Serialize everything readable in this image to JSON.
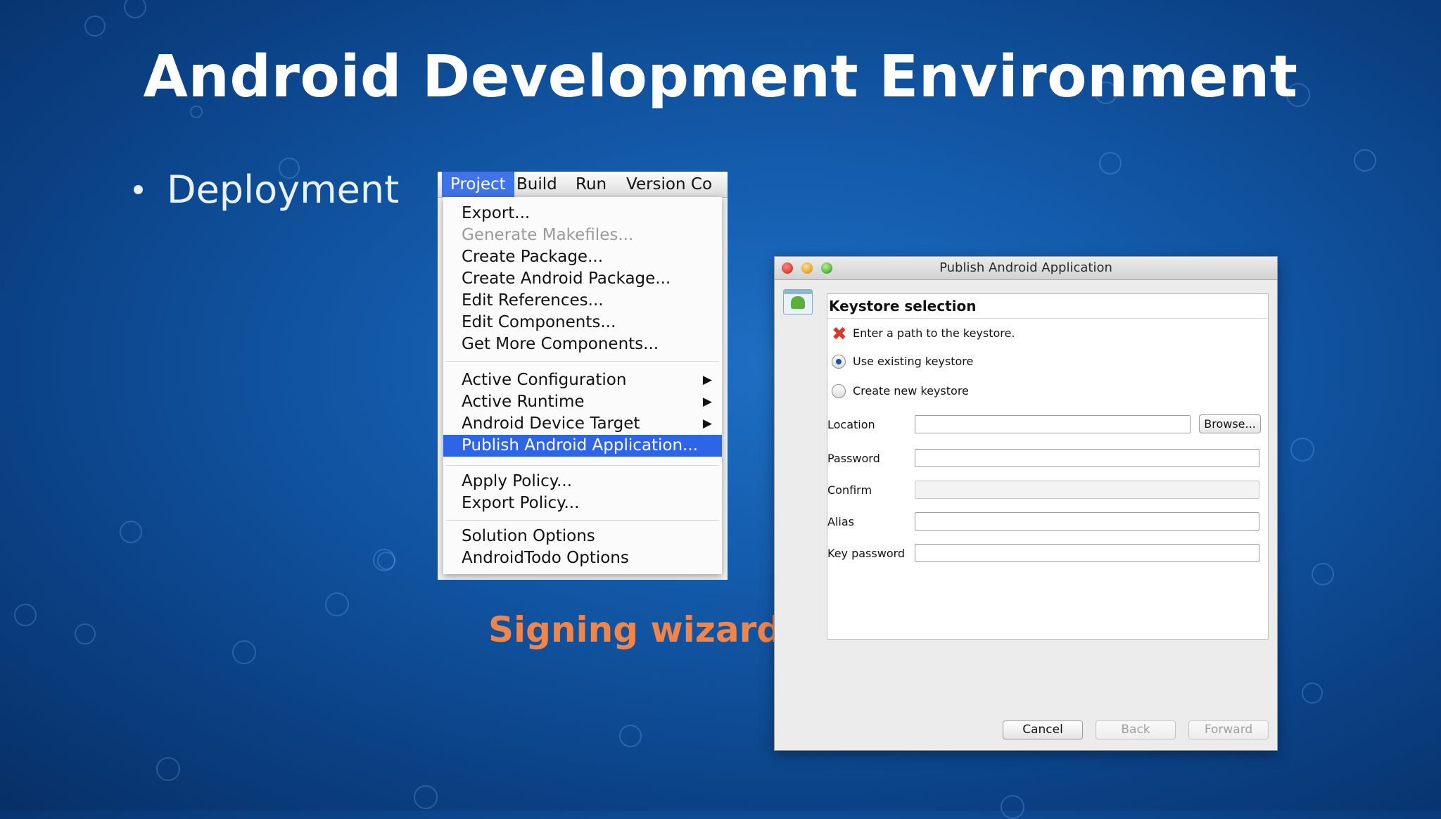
{
  "slide": {
    "title": "Android Development Environment",
    "bullet": "Deployment",
    "caption": "Signing wizard",
    "caption_color": "#f0854a"
  },
  "menubar": {
    "items": [
      "Project",
      "Build",
      "Run",
      "Version Co"
    ],
    "active_item": "Project"
  },
  "menu": {
    "items": [
      {
        "label": "Export..."
      },
      {
        "label": "Generate Makefiles...",
        "disabled": true
      },
      {
        "label": "Create Package..."
      },
      {
        "label": "Create Android Package..."
      },
      {
        "label": "Edit References..."
      },
      {
        "label": "Edit Components..."
      },
      {
        "label": "Get More Components..."
      },
      {
        "label": "Active Configuration",
        "submenu": true
      },
      {
        "label": "Active Runtime",
        "submenu": true
      },
      {
        "label": "Android Device Target",
        "submenu": true
      },
      {
        "label": "Publish Android Application...",
        "highlighted": true
      },
      {
        "label": "Apply Policy..."
      },
      {
        "label": "Export Policy..."
      },
      {
        "label": "Solution Options"
      },
      {
        "label": "AndroidTodo Options"
      }
    ],
    "submenu_arrow": "▶",
    "highlight_color": "#2e65e6"
  },
  "dialog": {
    "title": "Publish Android Application",
    "section_title": "Keystore selection",
    "error_icon": "error-x-icon",
    "error_message": "Enter a path to the keystore.",
    "radio_existing": "Use existing keystore",
    "radio_new": "Create new keystore",
    "selected_radio": "existing",
    "fields": {
      "location_label": "Location",
      "location_value": "",
      "password_label": "Password",
      "password_value": "",
      "confirm_label": "Confirm",
      "confirm_value": "",
      "alias_label": "Alias",
      "alias_value": "",
      "key_password_label": "Key password",
      "key_password_value": ""
    },
    "browse_button": "Browse...",
    "buttons": {
      "cancel": "Cancel",
      "back": "Back",
      "forward": "Forward"
    }
  }
}
